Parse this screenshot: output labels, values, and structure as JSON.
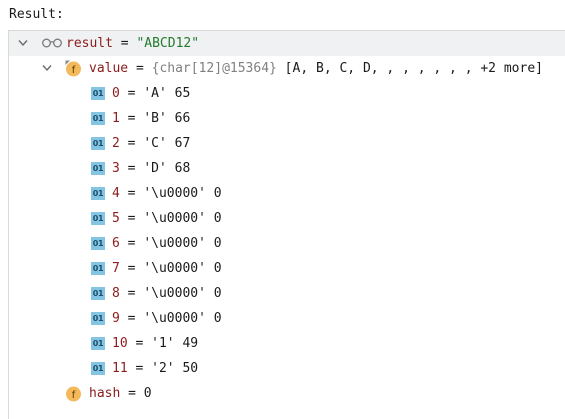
{
  "header": {
    "label": "Result:"
  },
  "result": {
    "name": "result",
    "eq": " = ",
    "value": "\"ABCD12\""
  },
  "value_field": {
    "name": "value",
    "eq": " = ",
    "type": "{char[12]@15364}",
    "preview": " [A, B, C, D, , , , , , , +2 more]"
  },
  "elements": [
    {
      "index": "0",
      "eq": " = ",
      "char": "'A'",
      "code": " 65"
    },
    {
      "index": "1",
      "eq": " = ",
      "char": "'B'",
      "code": " 66"
    },
    {
      "index": "2",
      "eq": " = ",
      "char": "'C'",
      "code": " 67"
    },
    {
      "index": "3",
      "eq": " = ",
      "char": "'D'",
      "code": " 68"
    },
    {
      "index": "4",
      "eq": " = ",
      "char": "'\\u0000'",
      "code": " 0"
    },
    {
      "index": "5",
      "eq": " = ",
      "char": "'\\u0000'",
      "code": " 0"
    },
    {
      "index": "6",
      "eq": " = ",
      "char": "'\\u0000'",
      "code": " 0"
    },
    {
      "index": "7",
      "eq": " = ",
      "char": "'\\u0000'",
      "code": " 0"
    },
    {
      "index": "8",
      "eq": " = ",
      "char": "'\\u0000'",
      "code": " 0"
    },
    {
      "index": "9",
      "eq": " = ",
      "char": "'\\u0000'",
      "code": " 0"
    },
    {
      "index": "10",
      "eq": " = ",
      "char": "'1'",
      "code": " 49"
    },
    {
      "index": "11",
      "eq": " = ",
      "char": "'2'",
      "code": " 50"
    }
  ],
  "hash_field": {
    "name": "hash",
    "eq": " = ",
    "value": "0"
  },
  "icons": {
    "field_icon_letter": "f",
    "primitive_icon_label": "01",
    "expand_icon": "chevron-down-icon",
    "watch_icon": "glasses-icon"
  },
  "colors": {
    "selected_row": "#f0f1f2",
    "name": "#8b1c1c",
    "string": "#237a2d",
    "type_gray": "#808080",
    "field_icon": "#f4b95a",
    "primitive_icon": "#84c5e4"
  }
}
